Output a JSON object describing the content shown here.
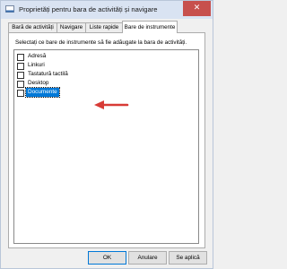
{
  "window": {
    "title": "Proprietăți pentru bara de activități și navigare",
    "close_glyph": "✕"
  },
  "tabs": [
    {
      "label": "Bară de activități"
    },
    {
      "label": "Navigare"
    },
    {
      "label": "Liste rapide"
    },
    {
      "label": "Bare de instrumente",
      "active": true
    }
  ],
  "panel": {
    "instruction": "Selectați ce bare de instrumente să fie adăugate la bara de activități.",
    "items": [
      {
        "label": "Adresă",
        "checked": false
      },
      {
        "label": "Linkuri",
        "checked": false
      },
      {
        "label": "Tastatură tactilă",
        "checked": false
      },
      {
        "label": "Desktop",
        "checked": false
      },
      {
        "label": "Documente",
        "checked": false,
        "selected": true
      }
    ]
  },
  "buttons": {
    "ok": "OK",
    "cancel": "Anulare",
    "apply": "Se aplică"
  },
  "colors": {
    "selection": "#0078d7",
    "annotation_arrow": "#d83b36",
    "close": "#c7504d"
  }
}
